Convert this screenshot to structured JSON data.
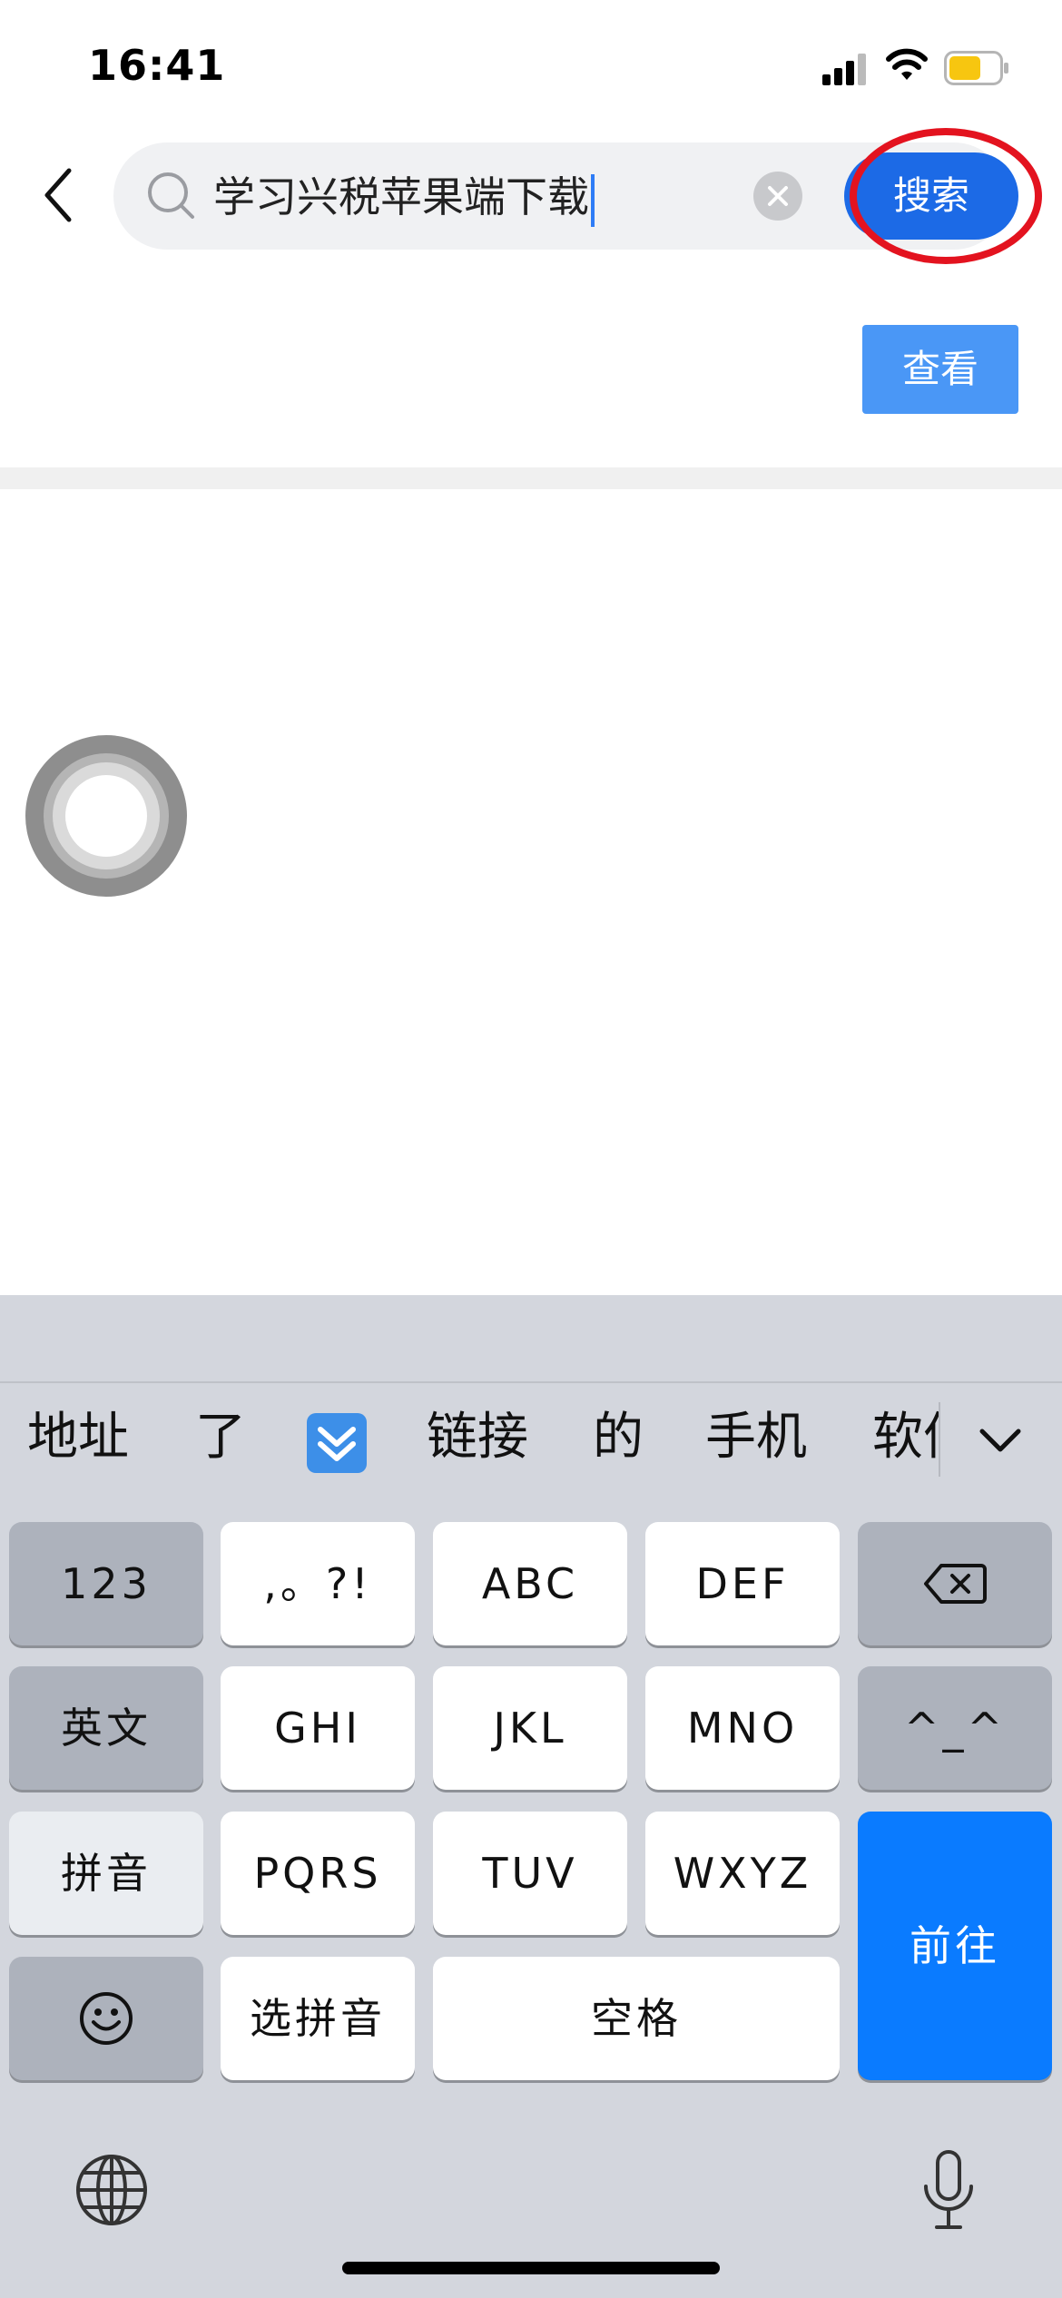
{
  "status_bar": {
    "time": "16:41"
  },
  "search": {
    "query": "学习兴税苹果端下载",
    "button_label": "搜索"
  },
  "view_button_label": "查看",
  "keyboard": {
    "candidates": [
      "地址",
      "了",
      "链接",
      "的",
      "手机",
      "软件"
    ],
    "candidate_emoji": "fast-down-button emoji",
    "keys": {
      "num": "123",
      "punct": ",。?!",
      "abc": "ABC",
      "def": "DEF",
      "english": "英文",
      "ghi": "GHI",
      "jkl": "JKL",
      "mno": "MNO",
      "emoticon": "^_^",
      "pinyin": "拼音",
      "pqrs": "PQRS",
      "tuv": "TUV",
      "wxyz": "WXYZ",
      "go": "前往",
      "select_pinyin": "选拼音",
      "space": "空格"
    }
  },
  "colors": {
    "accent_blue": "#1c6ae6",
    "annotation_red": "#e3131f",
    "keyboard_bg": "#d3d6dd"
  }
}
